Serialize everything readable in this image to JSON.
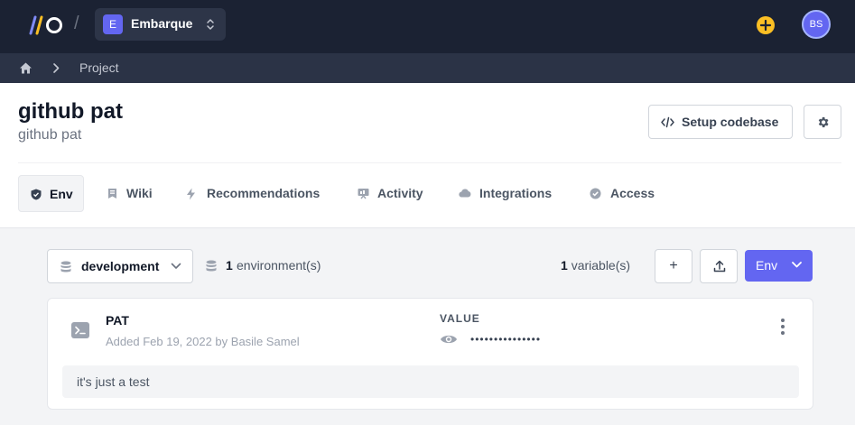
{
  "topbar": {
    "separator": "/",
    "project_switcher": {
      "badge": "E",
      "name": "Embarque"
    },
    "avatar_initials": "BS"
  },
  "breadcrumb": {
    "current": "Project"
  },
  "header": {
    "title": "github pat",
    "subtitle": "github pat",
    "setup_label": "Setup codebase"
  },
  "tabs": [
    {
      "label": "Env",
      "icon": "shield-icon",
      "active": true
    },
    {
      "label": "Wiki",
      "icon": "book-icon"
    },
    {
      "label": "Recommendations",
      "icon": "bolt-icon"
    },
    {
      "label": "Activity",
      "icon": "presentation-icon"
    },
    {
      "label": "Integrations",
      "icon": "cloud-icon"
    },
    {
      "label": "Access",
      "icon": "check-badge-icon"
    }
  ],
  "toolbar": {
    "environment": "development",
    "environment_count": "1",
    "environment_count_label": "environment(s)",
    "variable_count": "1",
    "variable_count_label": "variable(s)",
    "add_label": "+",
    "env_button_label": "Env"
  },
  "variable": {
    "name": "PAT",
    "meta": "Added Feb 19, 2022 by Basile Samel",
    "value_label": "VALUE",
    "masked_value": "•••••••••••••••",
    "note": "it's just a test"
  },
  "colors": {
    "topbar": "#1b2233",
    "breadcrumb_bar": "#2b3346",
    "accent": "#6366f1",
    "plus_button": "#fbbf24"
  }
}
